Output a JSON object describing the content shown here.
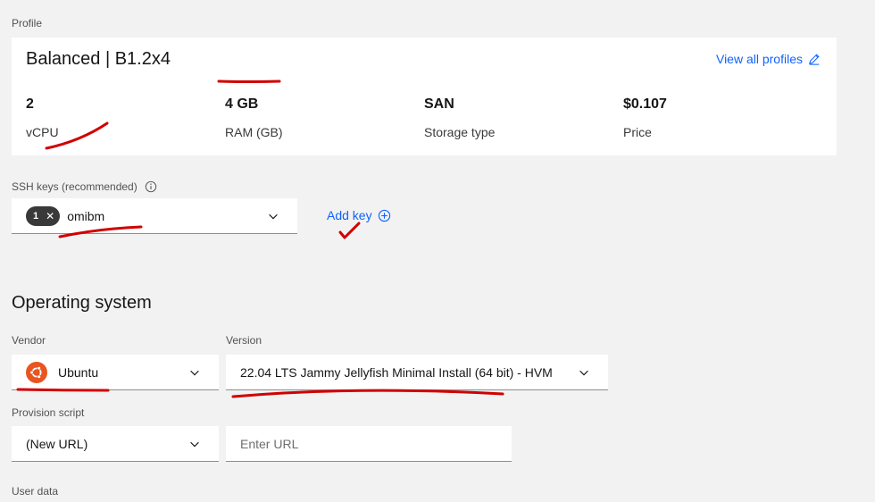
{
  "profile": {
    "section_label": "Profile",
    "name": "Balanced | B1.2x4",
    "view_all_label": "View all profiles",
    "specs": [
      {
        "value": "2",
        "label": "vCPU"
      },
      {
        "value": "4 GB",
        "label": "RAM (GB)"
      },
      {
        "value": "SAN",
        "label": "Storage type"
      },
      {
        "value": "$0.107",
        "label": "Price"
      }
    ]
  },
  "ssh": {
    "label": "SSH keys (recommended)",
    "count": "1",
    "selected": "omibm",
    "add_key_label": "Add key"
  },
  "os": {
    "title": "Operating system",
    "vendor_label": "Vendor",
    "vendor_value": "Ubuntu",
    "version_label": "Version",
    "version_value": "22.04 LTS Jammy Jellyfish Minimal Install (64 bit) - HVM"
  },
  "provision": {
    "label": "Provision script",
    "type_value": "(New URL)",
    "url_placeholder": "Enter URL"
  },
  "user_data": {
    "label": "User data"
  },
  "colors": {
    "link": "#0f62fe",
    "ubuntu_orange": "#e95420",
    "annotation_red": "#d00000"
  }
}
